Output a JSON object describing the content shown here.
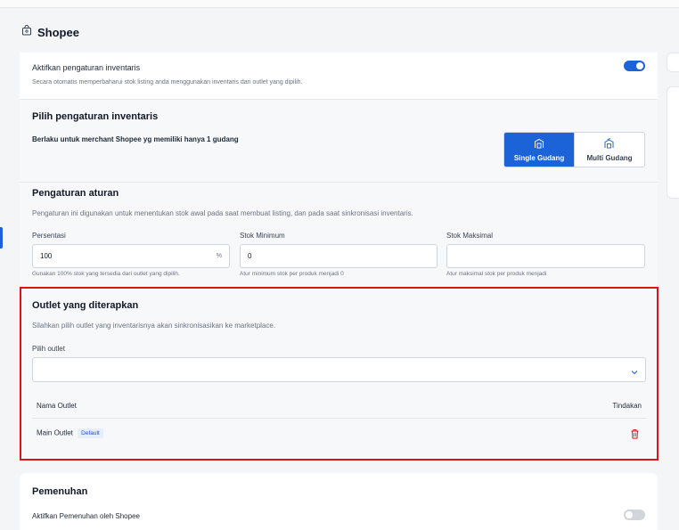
{
  "header": {
    "title": "Shopee"
  },
  "inventory_toggle": {
    "label": "Aktifkan pengaturan inventaris",
    "description": "Secara otomatis memperbaharui stok listing anda menggunakan inventaris dari outlet yang dipilih.",
    "enabled": true
  },
  "inventory_setting": {
    "title": "Pilih pengaturan inventaris",
    "subtitle": "Berlaku untuk merchant Shopee yg memiliki hanya 1 gudang",
    "options": [
      {
        "label": "Single Gudang",
        "selected": true
      },
      {
        "label": "Multi Gudang",
        "selected": false
      }
    ]
  },
  "rules": {
    "title": "Pengaturan aturan",
    "description": "Pengaturan ini digunakan untuk menentukan stok awal pada saat membuat listing, dan pada saat sinkronisasi inventaris.",
    "percentage": {
      "label": "Persentasi",
      "value": "100",
      "suffix": "%",
      "hint": "Gunakan 100% stok yang tersedia dari outlet yang dipilih."
    },
    "min_stock": {
      "label": "Stok Minimum",
      "value": "0",
      "hint": "Atur minimum stok per produk menjadi 0"
    },
    "max_stock": {
      "label": "Stok Maksimal",
      "value": "",
      "hint": "Atur maksimal stok per produk menjadi"
    }
  },
  "outlets": {
    "title": "Outlet yang diterapkan",
    "description": "Silahkan pilih outlet yang inventarisnya akan sinkronisasikan ke marketplace.",
    "select_label": "Pilih outlet",
    "columns": {
      "name": "Nama Outlet",
      "action": "Tindakan"
    },
    "rows": [
      {
        "name": "Main Outlet",
        "badge": "Default"
      }
    ]
  },
  "fulfillment": {
    "title": "Pemenuhan",
    "toggle_label": "Aktifkan Pemenuhan oleh Shopee",
    "enabled": false
  },
  "colors": {
    "primary": "#1d63d8",
    "danger": "#dc1414"
  }
}
